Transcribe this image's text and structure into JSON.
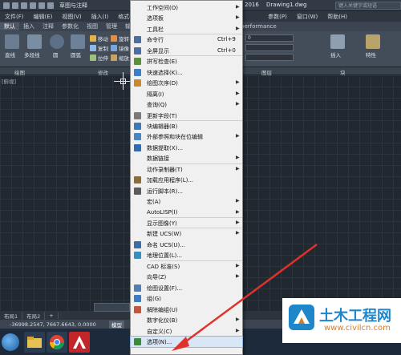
{
  "title_bar": {
    "workspace": "草图与注释",
    "version": "2016",
    "file_name": "Drawing1.dwg",
    "search_placeholder": "键入关键字或短语"
  },
  "menu_bar": [
    "文件(F)",
    "编辑(E)",
    "视图(V)",
    "插入(I)",
    "格式(O)",
    "参数(P)",
    "窗口(W)",
    "帮助(H)"
  ],
  "ribbon_tabs": [
    "默认",
    "插入",
    "注释",
    "参数化",
    "视图",
    "管理",
    "输出",
    "performance"
  ],
  "ribbon_tools": {
    "line": "直线",
    "polyline": "多段线",
    "circle": "圆",
    "arc": "圆弧",
    "move": "移动",
    "rotate": "旋转",
    "copy": "复制",
    "mirror": "镜像",
    "stretch": "拉伸",
    "scale": "缩放",
    "insert": "插入",
    "properties": "特性",
    "layer_value": "0"
  },
  "panel_labels": {
    "draw": "绘图",
    "modify": "修改",
    "layers": "图层",
    "block": "块"
  },
  "canvas": {
    "view_label": "[俯视]"
  },
  "layout_tabs": [
    "布局1",
    "布局2",
    "+"
  ],
  "status_bar": {
    "coordinates": "-36998.2547, 7667.6643, 0.0000",
    "model_label": "模型"
  },
  "context_menu": {
    "items": [
      {
        "label": "工作空间(O)",
        "shortcut": "",
        "submenu": true,
        "icon": "none"
      },
      {
        "label": "选项板",
        "shortcut": "",
        "submenu": true,
        "icon": "none"
      },
      {
        "label": "工具栏",
        "shortcut": "",
        "submenu": true,
        "icon": "none"
      },
      {
        "label": "命令行",
        "shortcut": "Ctrl+9",
        "submenu": false,
        "icon": "command-line-icon"
      },
      {
        "label": "全屏显示",
        "shortcut": "Ctrl+0",
        "submenu": false,
        "icon": "fullscreen-icon"
      },
      {
        "label": "拼写检查(E)",
        "shortcut": "",
        "submenu": false,
        "icon": "spellcheck-icon"
      },
      {
        "label": "快速选择(K)...",
        "shortcut": "",
        "submenu": false,
        "icon": "quick-select-icon"
      },
      {
        "label": "绘图次序(D)",
        "shortcut": "",
        "submenu": true,
        "icon": "draw-order-icon"
      },
      {
        "label": "隔离(I)",
        "shortcut": "",
        "submenu": true,
        "icon": "none"
      },
      {
        "label": "查询(Q)",
        "shortcut": "",
        "submenu": true,
        "icon": "none"
      },
      {
        "label": "更新字段(T)",
        "shortcut": "",
        "submenu": false,
        "icon": "update-fields-icon"
      },
      {
        "label": "块编辑器(B)",
        "shortcut": "",
        "submenu": false,
        "icon": "block-editor-icon"
      },
      {
        "label": "外部参照和块在位编辑",
        "shortcut": "",
        "submenu": true,
        "icon": "xref-icon"
      },
      {
        "label": "数据提取(X)...",
        "shortcut": "",
        "submenu": false,
        "icon": "data-extraction-icon"
      },
      {
        "label": "数据链接",
        "shortcut": "",
        "submenu": true,
        "icon": "none"
      },
      {
        "label": "动作录制器(T)",
        "shortcut": "",
        "submenu": true,
        "icon": "none"
      },
      {
        "label": "加载应用程序(L)...",
        "shortcut": "",
        "submenu": false,
        "icon": "load-app-icon"
      },
      {
        "label": "运行脚本(R)...",
        "shortcut": "",
        "submenu": false,
        "icon": "run-script-icon"
      },
      {
        "label": "宏(A)",
        "shortcut": "",
        "submenu": true,
        "icon": "none"
      },
      {
        "label": "AutoLISP(I)",
        "shortcut": "",
        "submenu": true,
        "icon": "none"
      },
      {
        "label": "显示图像(Y)",
        "shortcut": "",
        "submenu": true,
        "icon": "none"
      },
      {
        "label": "新建 UCS(W)",
        "shortcut": "",
        "submenu": true,
        "icon": "none"
      },
      {
        "label": "命名 UCS(U)...",
        "shortcut": "",
        "submenu": false,
        "icon": "named-ucs-icon"
      },
      {
        "label": "地理位置(L)...",
        "shortcut": "",
        "submenu": false,
        "icon": "geolocation-icon"
      },
      {
        "label": "CAD 标准(S)",
        "shortcut": "",
        "submenu": true,
        "icon": "none"
      },
      {
        "label": "向导(Z)",
        "shortcut": "",
        "submenu": true,
        "icon": "none"
      },
      {
        "label": "绘图设置(F)...",
        "shortcut": "",
        "submenu": false,
        "icon": "drafting-settings-icon"
      },
      {
        "label": "组(G)",
        "shortcut": "",
        "submenu": false,
        "icon": "group-icon"
      },
      {
        "label": "解除编组(U)",
        "shortcut": "",
        "submenu": false,
        "icon": "ungroup-icon"
      },
      {
        "label": "数字化仪(B)",
        "shortcut": "",
        "submenu": true,
        "icon": "none"
      },
      {
        "label": "自定义(C)",
        "shortcut": "",
        "submenu": true,
        "icon": "none"
      },
      {
        "label": "选项(N)...",
        "shortcut": "",
        "submenu": false,
        "icon": "options-icon"
      }
    ]
  },
  "watermark": {
    "title": "土木工程网",
    "url": "www.civilcn.com"
  },
  "colors": {
    "menu_background": "#f0f0f0",
    "annotation_arrow": "#e0312b",
    "canvas_background": "#212830",
    "watermark_blue": "#1f86c9",
    "watermark_orange": "#e07b1d"
  }
}
